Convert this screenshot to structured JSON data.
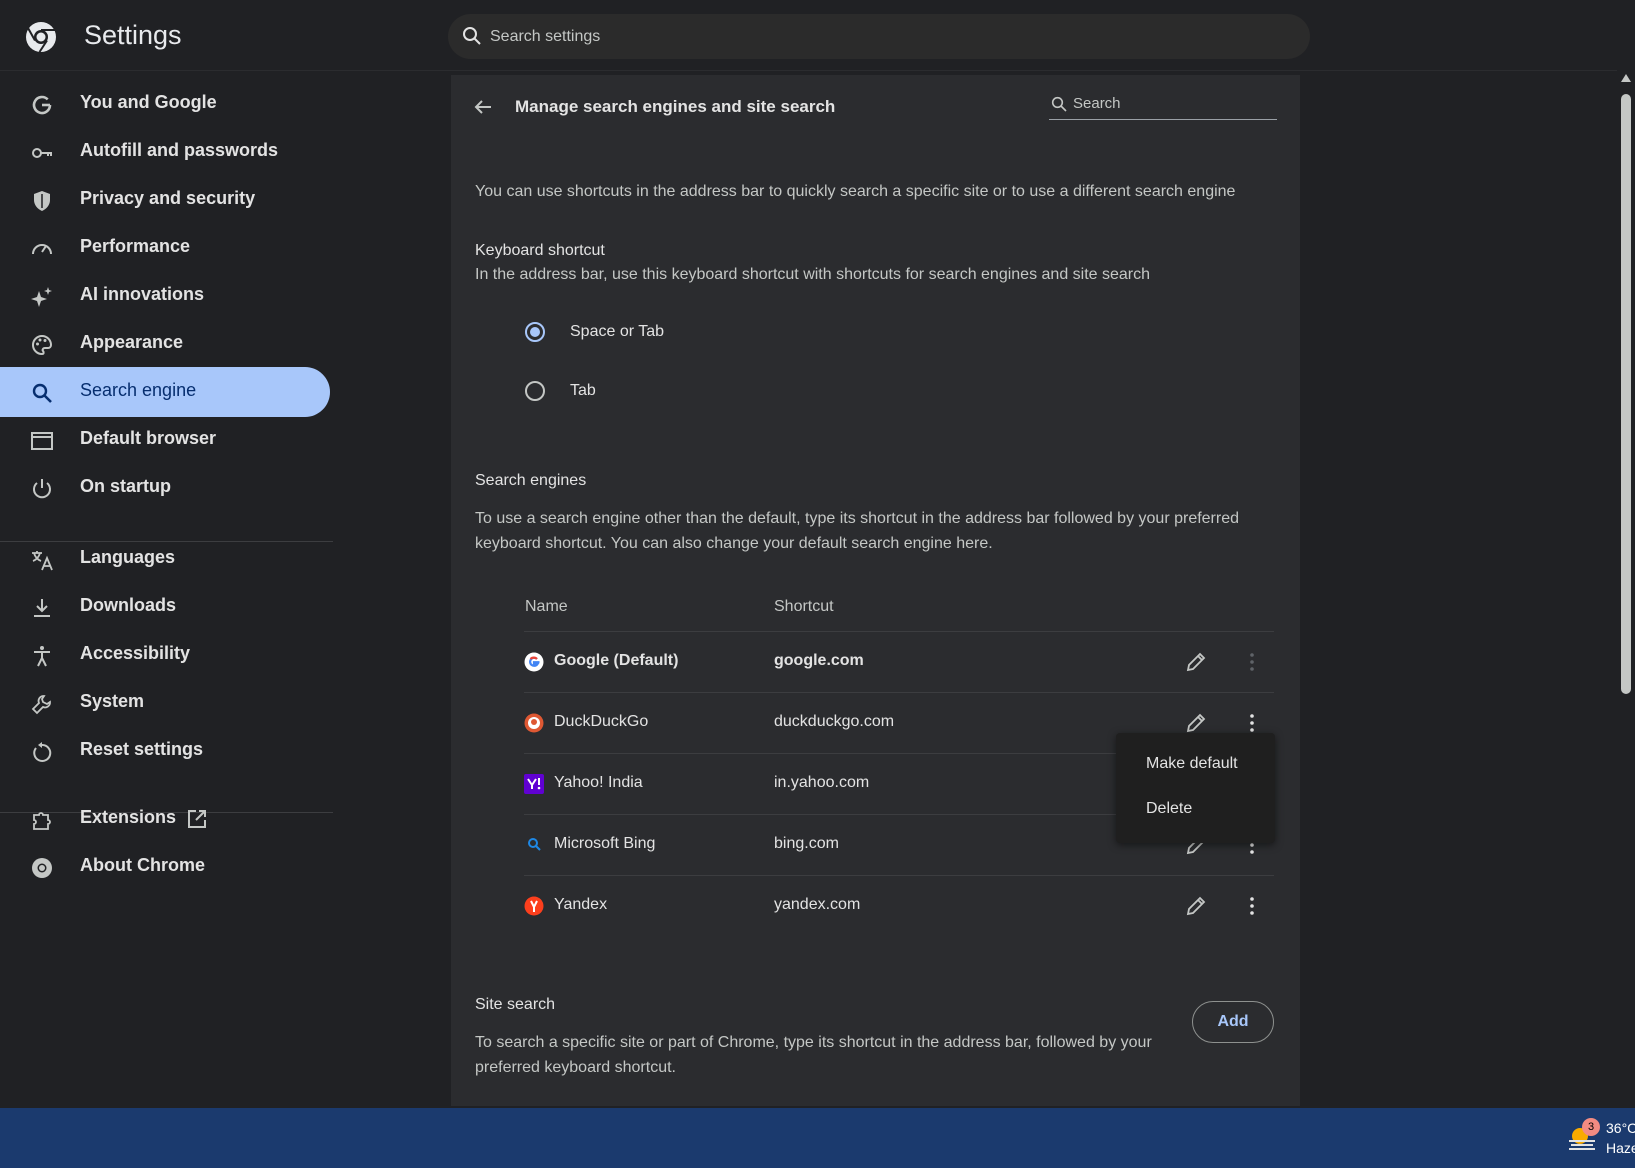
{
  "header": {
    "title": "Settings",
    "search_placeholder": "Search settings"
  },
  "sidebar": {
    "items": [
      {
        "label": "You and Google",
        "icon": "google-g-icon"
      },
      {
        "label": "Autofill and passwords",
        "icon": "key-icon"
      },
      {
        "label": "Privacy and security",
        "icon": "shield-icon"
      },
      {
        "label": "Performance",
        "icon": "speedometer-icon"
      },
      {
        "label": "AI innovations",
        "icon": "sparkle-icon"
      },
      {
        "label": "Appearance",
        "icon": "palette-icon"
      },
      {
        "label": "Search engine",
        "icon": "search-icon",
        "active": true
      },
      {
        "label": "Default browser",
        "icon": "browser-window-icon"
      },
      {
        "label": "On startup",
        "icon": "power-icon"
      },
      {
        "label": "Languages",
        "icon": "translate-icon"
      },
      {
        "label": "Downloads",
        "icon": "download-icon"
      },
      {
        "label": "Accessibility",
        "icon": "accessibility-icon"
      },
      {
        "label": "System",
        "icon": "wrench-icon"
      },
      {
        "label": "Reset settings",
        "icon": "reset-icon"
      },
      {
        "label": "Extensions",
        "icon": "puzzle-icon"
      },
      {
        "label": "About Chrome",
        "icon": "chrome-icon"
      }
    ]
  },
  "page": {
    "title": "Manage search engines and site search",
    "search_placeholder": "Search",
    "intro": "You can use shortcuts in the address bar to quickly search a specific site or to use a different search engine",
    "keyboard_shortcut": {
      "heading": "Keyboard shortcut",
      "description": "In the address bar, use this keyboard shortcut with shortcuts for search engines and site search",
      "options": [
        "Space or Tab",
        "Tab"
      ],
      "selected": "Space or Tab"
    },
    "search_engines": {
      "heading": "Search engines",
      "description_line1": "To use a search engine other than the default, type its shortcut in the address bar followed by your preferred",
      "description_line2": "keyboard shortcut. You can also change your default search engine here.",
      "columns": {
        "name": "Name",
        "shortcut": "Shortcut"
      },
      "rows": [
        {
          "name": "Google (Default)",
          "shortcut": "google.com",
          "icon": "google-favicon",
          "default": true
        },
        {
          "name": "DuckDuckGo",
          "shortcut": "duckduckgo.com",
          "icon": "duckduckgo-favicon"
        },
        {
          "name": "Yahoo! India",
          "shortcut": "in.yahoo.com",
          "icon": "yahoo-favicon"
        },
        {
          "name": "Microsoft Bing",
          "shortcut": "bing.com",
          "icon": "bing-favicon"
        },
        {
          "name": "Yandex",
          "shortcut": "yandex.com",
          "icon": "yandex-favicon"
        }
      ]
    },
    "context_menu": {
      "items": [
        "Make default",
        "Delete"
      ]
    },
    "site_search": {
      "heading": "Site search",
      "description_line1": "To search a specific site or part of Chrome, type its shortcut in the address bar, followed by your",
      "description_line2": "preferred keyboard shortcut.",
      "add_label": "Add"
    }
  },
  "taskbar": {
    "weather_temp": "36°C",
    "weather_desc": "Haze",
    "badge_count": "3"
  },
  "colors": {
    "background": "#202124",
    "card": "#2b2c2f",
    "accent": "#a8c7fa",
    "active_text": "#062e6f",
    "taskbar": "#1b3a6e"
  }
}
